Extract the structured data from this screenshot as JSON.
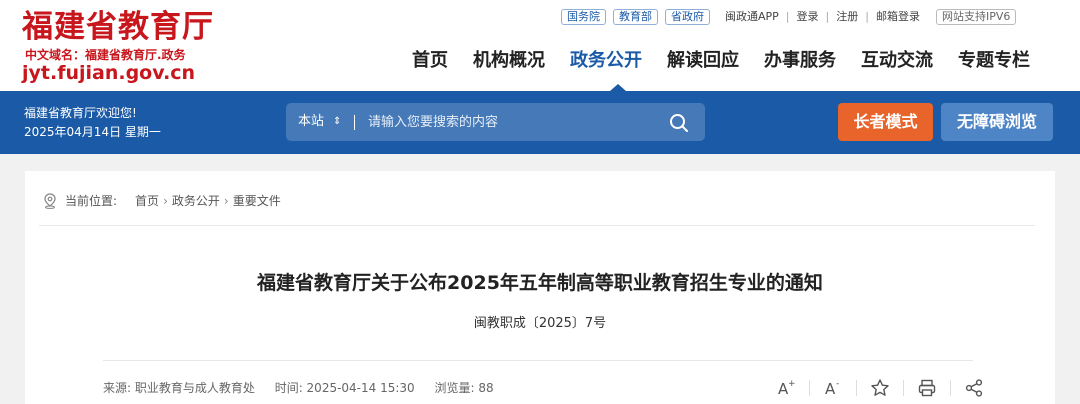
{
  "header": {
    "logo_title": "福建省教育厅",
    "logo_subtitle": "中文域名：福建省教育厅.政务",
    "logo_domain": "jyt.fujian.gov.cn",
    "top_links": {
      "pill1": "国务院",
      "pill2": "教育部",
      "pill3": "省政府",
      "app": "闽政通APP",
      "login": "登录",
      "register": "注册",
      "mail": "邮箱登录",
      "ipv6": "网站支持IPV6"
    },
    "nav": [
      "首页",
      "机构概况",
      "政务公开",
      "解读回应",
      "办事服务",
      "互动交流",
      "专题专栏"
    ]
  },
  "bluebar": {
    "welcome": "福建省教育厅欢迎您!",
    "date": "2025年04月14日 星期一",
    "search_scope": "本站",
    "search_placeholder": "请输入您要搜索的内容",
    "elder_mode": "长者模式",
    "accessible": "无障碍浏览"
  },
  "breadcrumb": {
    "label": "当前位置:",
    "home": "首页",
    "section": "政务公开",
    "page": "重要文件"
  },
  "article": {
    "title": "福建省教育厅关于公布2025年五年制高等职业教育招生专业的通知",
    "doc_number": "闽教职成〔2025〕7号",
    "source": "来源: 职业教育与成人教育处",
    "time": "时间: 2025-04-14 15:30",
    "views": "浏览量: 88"
  },
  "colors": {
    "brand_red": "#c8161d",
    "brand_blue": "#1b5aa6",
    "elder_orange": "#e8642b"
  }
}
